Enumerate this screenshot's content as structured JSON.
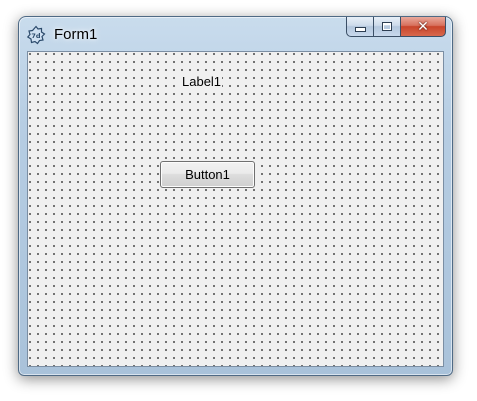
{
  "window": {
    "title": "Form1",
    "icon": "delphi-form-icon"
  },
  "caption_buttons": {
    "minimize": "minimize-icon",
    "maximize": "maximize-icon",
    "close": "close-icon"
  },
  "form": {
    "label": "Label1",
    "button": "Button1"
  },
  "colors": {
    "close_button": "#c8442b",
    "client_background": "#f0f0f0",
    "grid_dot": "#000000"
  }
}
